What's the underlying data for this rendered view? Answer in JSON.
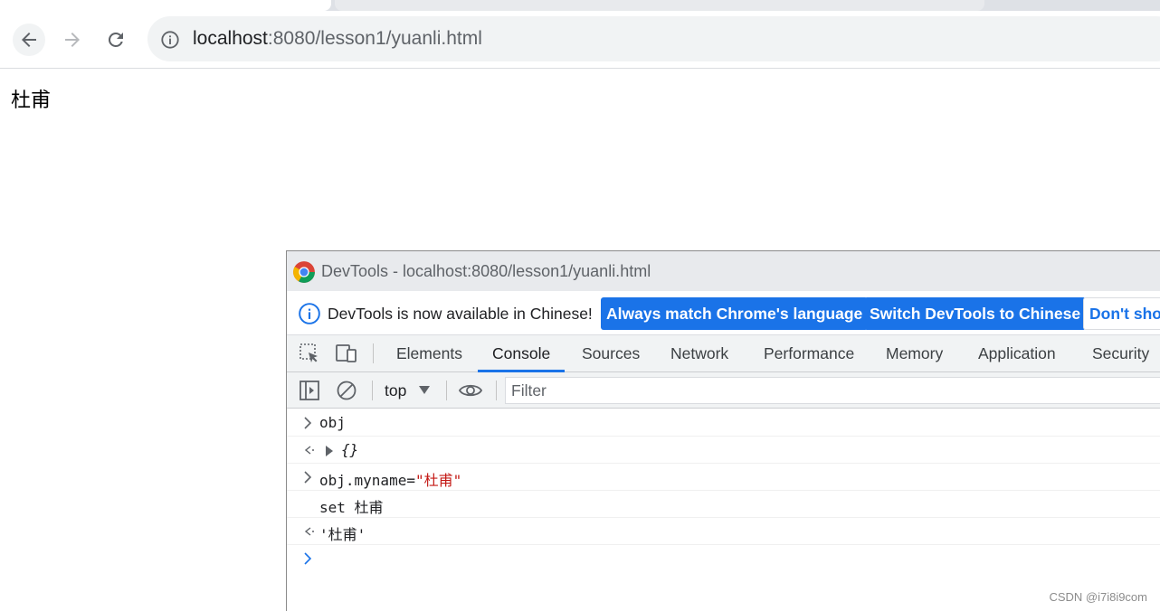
{
  "browser": {
    "address_host": "localhost",
    "address_rest": ":8080/lesson1/yuanli.html"
  },
  "page": {
    "body_text": "杜甫"
  },
  "devtools": {
    "window_title": "DevTools - localhost:8080/lesson1/yuanli.html",
    "infobar": {
      "message": "DevTools is now available in Chinese!",
      "btn_match": "Always match Chrome's language",
      "btn_switch": "Switch DevTools to Chinese",
      "btn_dont": "Don't show again"
    },
    "tabs": [
      "Elements",
      "Console",
      "Sources",
      "Network",
      "Performance",
      "Memory",
      "Application",
      "Security"
    ],
    "active_tab": "Console",
    "context": "top",
    "filter_placeholder": "Filter",
    "console": {
      "line1_input": "obj",
      "line2_result": "{}",
      "line3_input_prefix": "obj.myname=",
      "line3_input_string": "\"杜甫\"",
      "line4_log": "set 杜甫",
      "line5_result": "'杜甫'"
    }
  },
  "watermark": "CSDN @i7i8i9com",
  "colors": {
    "accent": "#1a73e8",
    "string": "#c41a16",
    "prompt_blue": "#1a73e8"
  }
}
